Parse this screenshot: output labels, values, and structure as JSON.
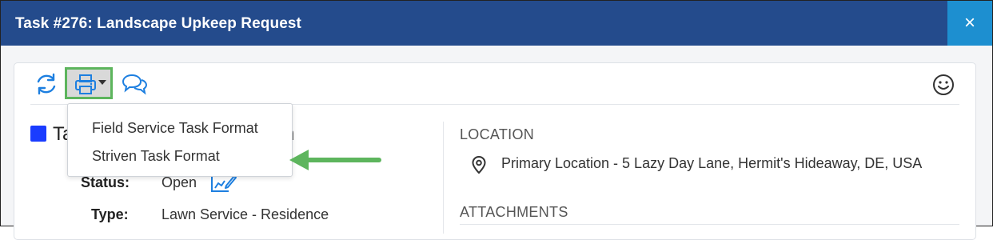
{
  "window": {
    "title": "Task #276: Landscape Upkeep Request",
    "close_glyph": "×"
  },
  "toolbar": {
    "icons": [
      "refresh-icon",
      "printer-icon",
      "caret-down-icon",
      "chat-icon",
      "smiley-icon"
    ]
  },
  "print_menu": {
    "items": [
      {
        "label": "Field Service Task Format"
      },
      {
        "label": "Striven Task Format"
      }
    ]
  },
  "task": {
    "heading_start": "Ta",
    "heading_end": "n",
    "square_color": "#1a3cff",
    "status_label": "Status:",
    "status_value": "Open",
    "type_label": "Type:",
    "type_value": "Lawn Service - Residence"
  },
  "location": {
    "section_title": "LOCATION",
    "address": "Primary Location - 5 Lazy Day Lane, Hermit's Hideaway, DE, USA"
  },
  "attachments": {
    "section_title": "ATTACHMENTS"
  },
  "colors": {
    "titlebar": "#244b8c",
    "close_button": "#1d8fd0",
    "icon_blue": "#1d7fe0",
    "highlight_green": "#5db55d"
  }
}
